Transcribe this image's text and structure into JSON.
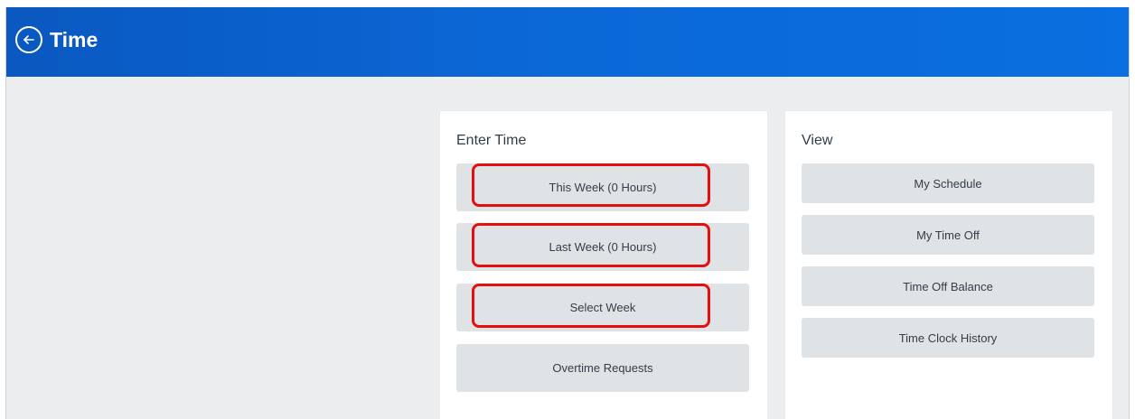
{
  "header": {
    "title": "Time",
    "back_icon": "arrow-left-icon",
    "background_color": "#0b65d4"
  },
  "enter_time": {
    "title": "Enter Time",
    "buttons": [
      {
        "label": "This Week (0 Hours)",
        "highlighted": true
      },
      {
        "label": "Last Week (0 Hours)",
        "highlighted": true
      },
      {
        "label": "Select Week",
        "highlighted": true
      },
      {
        "label": "Overtime Requests",
        "highlighted": false
      }
    ]
  },
  "view": {
    "title": "View",
    "buttons": [
      {
        "label": "My Schedule"
      },
      {
        "label": "My Time Off"
      },
      {
        "label": "Time Off Balance"
      },
      {
        "label": "Time Clock History"
      }
    ]
  },
  "colors": {
    "button_background": "#dfe3e6",
    "page_background": "#ebedef",
    "highlight_border": "#e60f0f"
  }
}
